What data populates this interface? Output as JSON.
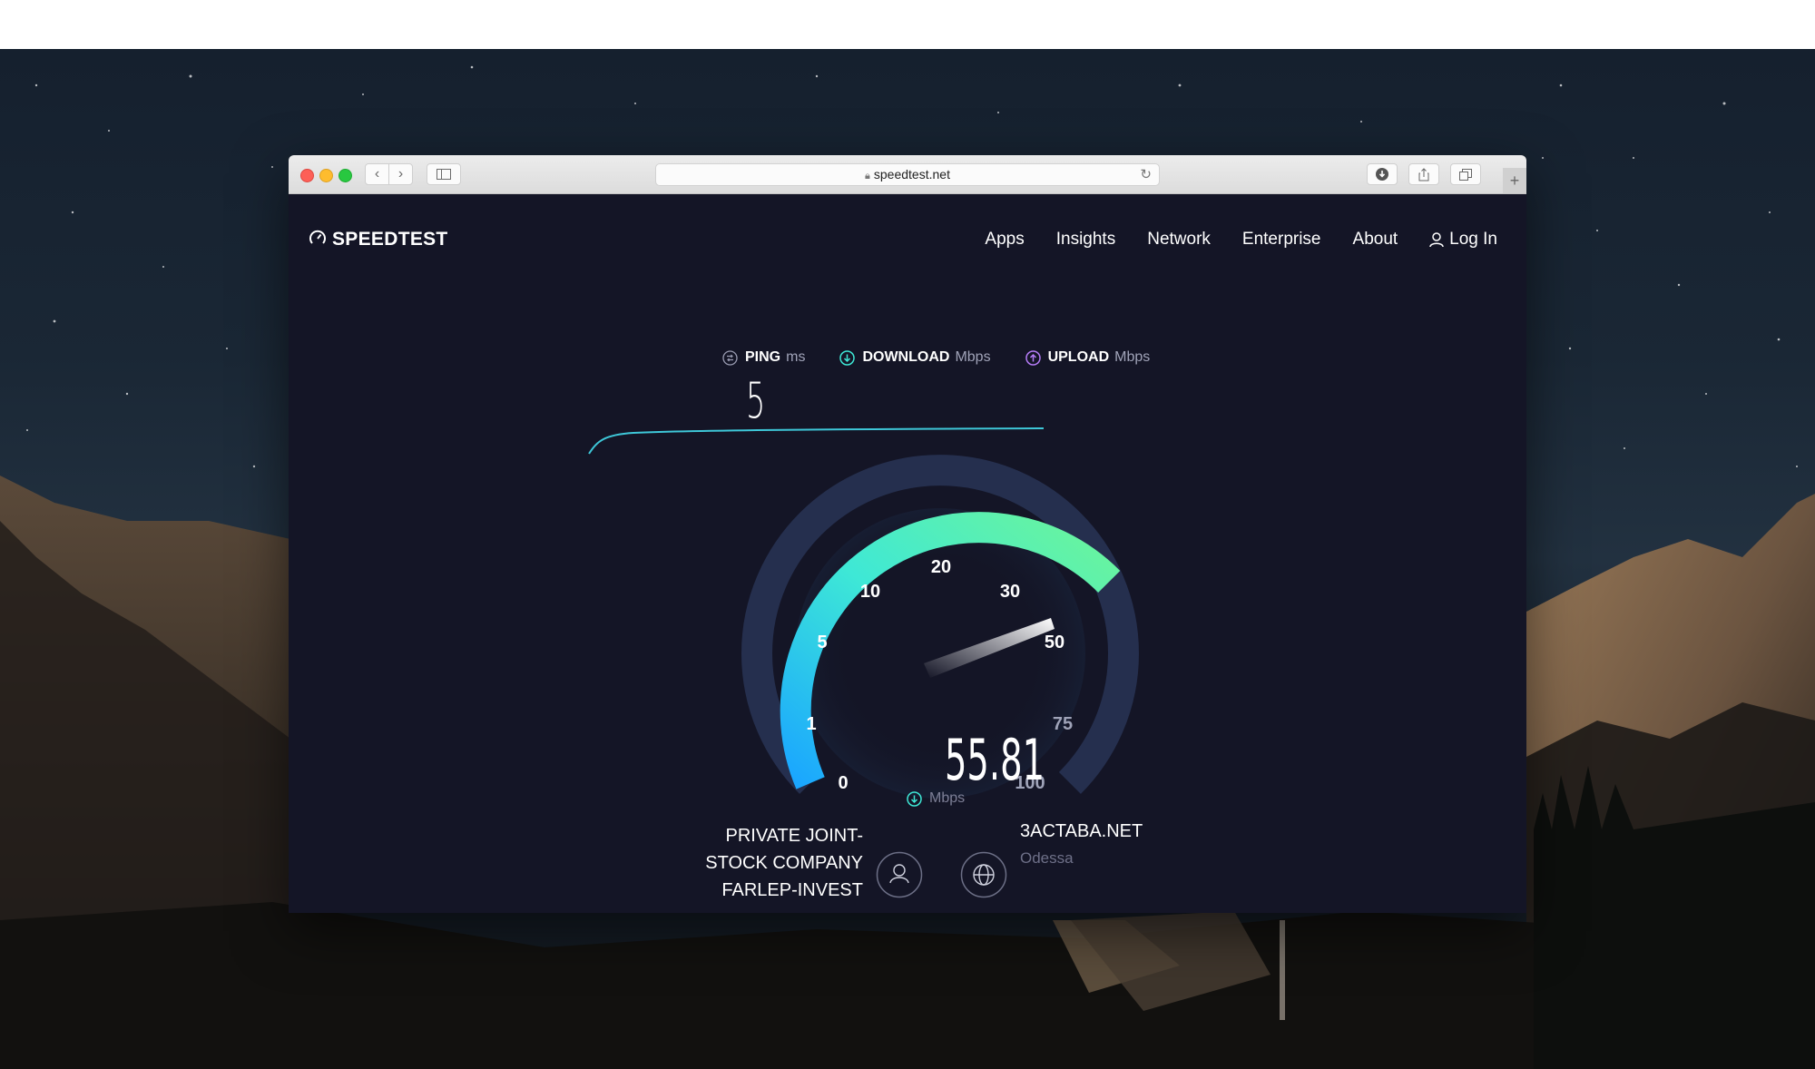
{
  "browser": {
    "url": "speedtest.net",
    "tabs_icon": "tabs-icon",
    "icons": [
      "chevron-left-icon",
      "chevron-right-icon",
      "sidebar-icon",
      "lock-icon",
      "reload-icon",
      "download-icon",
      "share-icon",
      "tabs-icon",
      "plus-icon"
    ]
  },
  "site": {
    "logo": "SPEEDTEST",
    "nav": {
      "apps": "Apps",
      "insights": "Insights",
      "network": "Network",
      "enterprise": "Enterprise",
      "about": "About",
      "login": "Log In"
    }
  },
  "metrics": {
    "ping": {
      "label": "PING",
      "unit": "ms",
      "value": "5"
    },
    "download": {
      "label": "DOWNLOAD",
      "unit": "Mbps"
    },
    "upload": {
      "label": "UPLOAD",
      "unit": "Mbps"
    }
  },
  "gauge": {
    "ticks": [
      "0",
      "1",
      "5",
      "10",
      "20",
      "30",
      "50",
      "75",
      "100"
    ],
    "speed": "55.81",
    "unit": "Mbps",
    "colors": {
      "low": "#1aa6ff",
      "mid": "#3ee8d6",
      "high": "#6cf59a",
      "track": "#252f4e"
    }
  },
  "connection": {
    "isp_lines": [
      "PRIVATE JOINT-",
      "STOCK COMPANY",
      "FARLEP-INVEST"
    ],
    "server": "3ACTABA.NET",
    "city": "Odessa"
  }
}
